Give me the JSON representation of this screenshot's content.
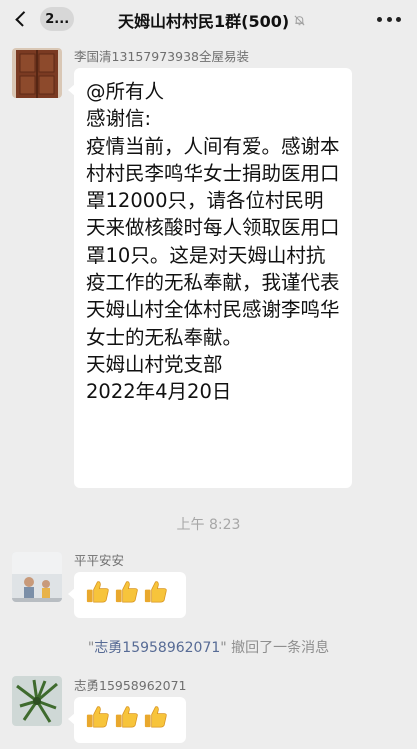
{
  "header": {
    "back_label": "2...",
    "title": "天姆山村村民1群(500)",
    "mute_icon": "bell-off-icon",
    "more_icon": "more-dots-icon"
  },
  "messages": [
    {
      "sender": "李国清13157973938全屋易装",
      "avatar_icon": "wooden-door-avatar",
      "text": "@所有人\n感谢信:\n疫情当前，人间有爱。感谢本村村民李鸣华女士捐助医用口罩12000只，请各位村民明天来做核酸时每人领取医用口罩10只。这是对天姆山村抗疫工作的无私奉献，我谨代表天姆山村全体村民感谢李鸣华女士的无私奉献。\n天姆山村党支部\n2022年4月20日"
    }
  ],
  "timestamp": "上午 8:23",
  "message2": {
    "sender": "平平安安",
    "avatar_icon": "family-photo-avatar",
    "emoji": [
      "thumbs-up-icon",
      "thumbs-up-icon",
      "thumbs-up-icon"
    ]
  },
  "recall_notice": {
    "open_quote": "\"",
    "name": "志勇15958962071",
    "close_quote": "\"",
    "action": " 撤回了一条消息"
  },
  "message3": {
    "sender": "志勇15958962071",
    "avatar_icon": "palm-tree-avatar",
    "emoji": [
      "thumbs-up-icon",
      "thumbs-up-icon",
      "thumbs-up-icon"
    ]
  },
  "colors": {
    "background": "#ededed",
    "bubble": "#ffffff",
    "link_name": "#576b95",
    "thumb_yellow": "#f7c43b"
  }
}
